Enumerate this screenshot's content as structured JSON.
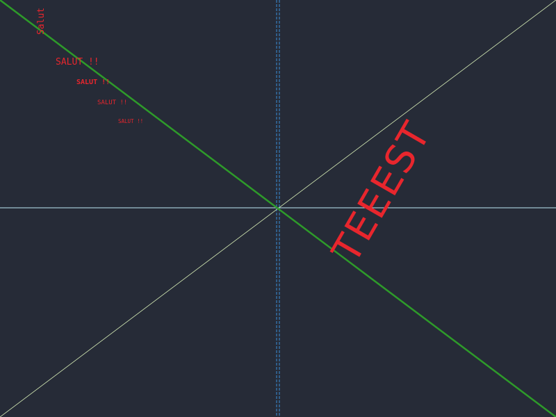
{
  "colors": {
    "background": "#262b37",
    "text_red": "#e8262d",
    "green_line": "#2e9b2a",
    "diagonal_thin": "#d9f0b8",
    "horizontal_line": "#bfe9f5",
    "vertical_dashed": "#3a8fd8"
  },
  "labels": {
    "vertical_text": "Salut",
    "salut_1": "SALUT !!",
    "salut_2": "SALUT !!",
    "salut_3": "SALUT !!",
    "salut_4": "SALUT !!",
    "big_text": "TEEEST"
  }
}
